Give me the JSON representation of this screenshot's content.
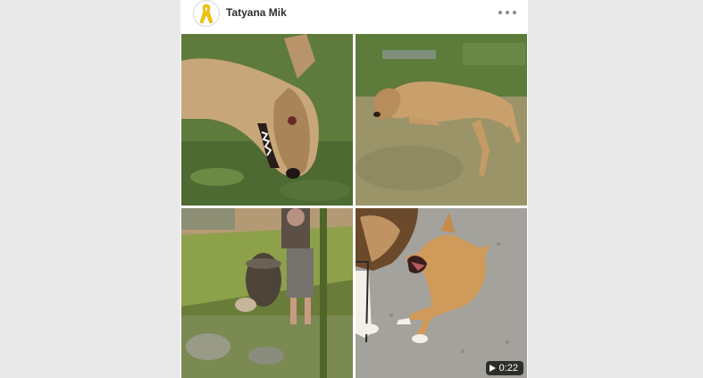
{
  "post": {
    "author": "Tatyana Mik",
    "avatar_icon": "yellow-ribbon-icon",
    "more_icon": "more-horizontal-icon"
  },
  "media": [
    {
      "type": "photo",
      "subject": "dog-lying-on-grass-closeup"
    },
    {
      "type": "photo",
      "subject": "dog-lying-on-grass"
    },
    {
      "type": "photo",
      "subject": "person-with-barrel-and-puppy"
    },
    {
      "type": "video",
      "subject": "puppy-yawning-on-gravel",
      "duration": "0:22"
    }
  ],
  "colors": {
    "background": "#e9e9ea",
    "card": "#ffffff",
    "author_text": "#2c2d2e",
    "ribbon": "#f2c600"
  }
}
